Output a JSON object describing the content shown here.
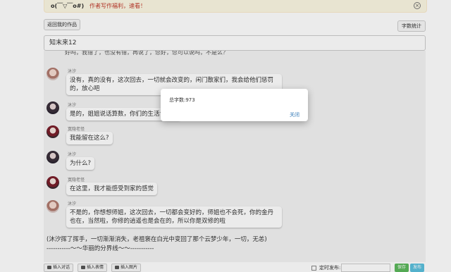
{
  "notice": {
    "face": "o(￣▽￣o#)",
    "message": "作者写作福利，速看！"
  },
  "buttons": {
    "back": "返回我的作品",
    "word_count": "字数统计"
  },
  "title_input": {
    "value": "知末来12"
  },
  "chat": {
    "truncated_line": "好吗，我错了，也没有错，再说了，您好，您可以说吗，不是么？",
    "messages": [
      {
        "sender": "沐汐",
        "text": "没有，真的没有，这次回去，一切就会改变的，闲门散家们，我会给他们惩罚的，放心吧",
        "avatar": "avatar-a"
      },
      {
        "sender": "沐汐",
        "text": "是的，姐姐说话算数，你们的生活肯定会",
        "avatar": "avatar-b"
      },
      {
        "sender": "寞隐老怪",
        "text": "我能留在这么?",
        "avatar": "avatar-c"
      },
      {
        "sender": "沐汐",
        "text": "为什么?",
        "avatar": "avatar-b"
      },
      {
        "sender": "寞隐老怪",
        "text": "在这里，我才能感受到家的感觉",
        "avatar": "avatar-c"
      },
      {
        "sender": "沐汐",
        "text": "不是的，你想想师姐，这次回去，一切都会变好的，师姐也不会死，你的金丹也在，当然啦，你修的逍遥也是会在的，所以你是双修的啦",
        "avatar": "avatar-a"
      }
    ],
    "narration_1": "(沐汐挥了挥手，一切渐渐消失，老祖褒在白光中变回了那个云梦少年，一切，无恙)",
    "narration_2": "-----------～～华丽的分界线～～-----------"
  },
  "toolbar": {
    "insert_dialog": "插入对话",
    "insert_emoji": "插入表情",
    "insert_image": "插入图片",
    "timed_publish": "定时发布:",
    "save": "保存",
    "publish": "发布"
  },
  "modal": {
    "body": "总字数:973",
    "close": "关闭"
  }
}
